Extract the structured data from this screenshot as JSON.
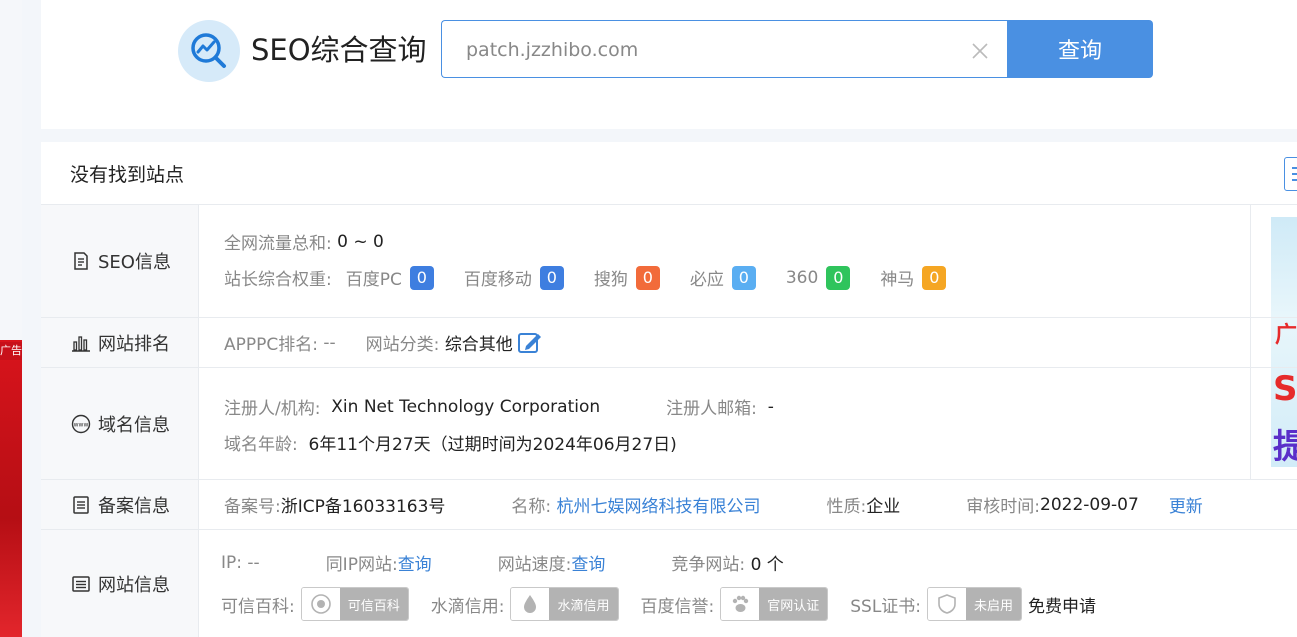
{
  "left_ad": {
    "tag": "广告"
  },
  "header": {
    "brand": "SEO综合查询",
    "search_value": "patch.jzzhibo.com",
    "search_button": "查询"
  },
  "notice": "没有找到站点",
  "seo": {
    "label": "SEO信息",
    "traffic_key": "全网流量总和:",
    "traffic_val": "0 ~ 0",
    "weight_key": "站长综合权重:",
    "weights": [
      {
        "name": "百度PC",
        "value": "0",
        "color": "#3e7ee0"
      },
      {
        "name": "百度移动",
        "value": "0",
        "color": "#3e7ee0"
      },
      {
        "name": "搜狗",
        "value": "0",
        "color": "#f26b3a"
      },
      {
        "name": "必应",
        "value": "0",
        "color": "#5aaef2"
      },
      {
        "name": "360",
        "value": "0",
        "color": "#2fc45c"
      },
      {
        "name": "神马",
        "value": "0",
        "color": "#f5a623"
      }
    ]
  },
  "rank": {
    "label": "网站排名",
    "apppc_key": "APPPC排名:",
    "apppc_val": "--",
    "category_key": "网站分类:",
    "category_val": "综合其他"
  },
  "domain": {
    "label": "域名信息",
    "registrant_key": "注册人/机构:",
    "registrant_val": "Xin Net Technology Corporation",
    "email_key": "注册人邮箱:",
    "email_val": "-",
    "age_key": "域名年龄:",
    "age_val": "6年11个月27天（过期时间为2024年06月27日)"
  },
  "icp": {
    "label": "备案信息",
    "no_key": "备案号:",
    "no_val": "浙ICP备16033163号",
    "name_key": "名称:",
    "name_val": "杭州七娱网络科技有限公司",
    "nature_key": "性质:",
    "nature_val": "企业",
    "audit_key": "审核时间:",
    "audit_val": "2022-09-07",
    "update": "更新"
  },
  "site": {
    "label": "网站信息",
    "ip_key": "IP:",
    "ip_val": "--",
    "sameip_key": "同IP网站:",
    "sameip_val": "查询",
    "speed_key": "网站速度:",
    "speed_val": "查询",
    "compete_key": "竞争网站:",
    "compete_val": "0 个",
    "kexin_key": "可信百科:",
    "kexin_badge": "可信百科",
    "shuidi_key": "水滴信用:",
    "shuidi_badge": "水滴信用",
    "baidu_key": "百度信誉:",
    "baidu_badge": "官网认证",
    "ssl_key": "SSL证书:",
    "ssl_badge": "未启用",
    "apply": "免费申请"
  }
}
